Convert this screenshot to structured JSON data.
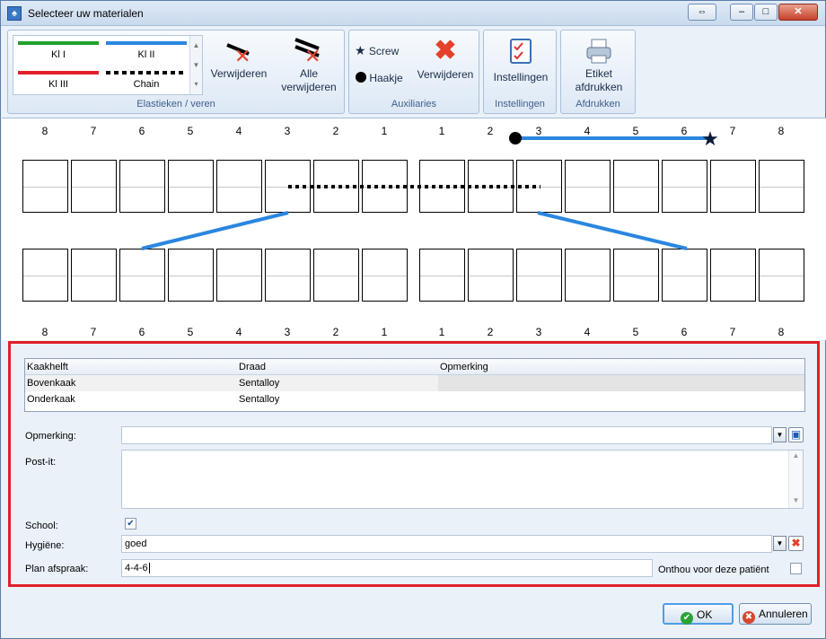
{
  "window": {
    "title": "Selecteer uw materialen"
  },
  "ribbon": {
    "elastieken": {
      "group_label": "Elastieken / veren",
      "gallery": [
        {
          "label": "Kl I",
          "color": "#1fa12a",
          "style": "solid"
        },
        {
          "label": "Kl II",
          "color": "#2a86e0",
          "style": "solid"
        },
        {
          "label": "Kl III",
          "color": "#e3202a",
          "style": "solid"
        },
        {
          "label": "Chain",
          "color": "#000000",
          "style": "dotted"
        }
      ],
      "remove_label": "Verwijderen",
      "remove_all_label": "Alle\nverwijderen"
    },
    "auxiliaries": {
      "group_label": "Auxiliaries",
      "screw_label": "Screw",
      "haakje_label": "Haakje",
      "remove_label": "Verwijderen"
    },
    "instellingen": {
      "group_label": "Instellingen",
      "button_label": "Instellingen"
    },
    "afdrukken": {
      "group_label": "Afdrukken",
      "button_label": "Etiket\nafdrukken"
    }
  },
  "chart": {
    "upper_numbers": [
      "8",
      "7",
      "6",
      "5",
      "4",
      "3",
      "2",
      "1",
      "1",
      "2",
      "3",
      "4",
      "5",
      "6",
      "7",
      "8"
    ],
    "lower_numbers": [
      "8",
      "7",
      "6",
      "5",
      "4",
      "3",
      "2",
      "1",
      "1",
      "2",
      "3",
      "4",
      "5",
      "6",
      "7",
      "8"
    ]
  },
  "table": {
    "headers": [
      "Kaakhelft",
      "Draad",
      "Opmerking"
    ],
    "rows": [
      {
        "kaakhelft": "Bovenkaak",
        "draad": "Sentalloy",
        "opmerking": ""
      },
      {
        "kaakhelft": "Onderkaak",
        "draad": "Sentalloy",
        "opmerking": ""
      }
    ]
  },
  "form": {
    "opmerking_label": "Opmerking:",
    "opmerking_value": "",
    "postit_label": "Post-it:",
    "postit_value": "",
    "school_label": "School:",
    "school_checked": true,
    "hygiene_label": "Hygiëne:",
    "hygiene_value": "goed",
    "plan_label": "Plan afspraak:",
    "plan_value": "4-4-6",
    "onthou_label": "Onthou voor deze patiënt",
    "onthou_checked": false
  },
  "footer": {
    "ok_label": "OK",
    "cancel_label": "Annuleren"
  },
  "colors": {
    "accent": "#2a86e0",
    "highlight_border": "#e0202a"
  }
}
